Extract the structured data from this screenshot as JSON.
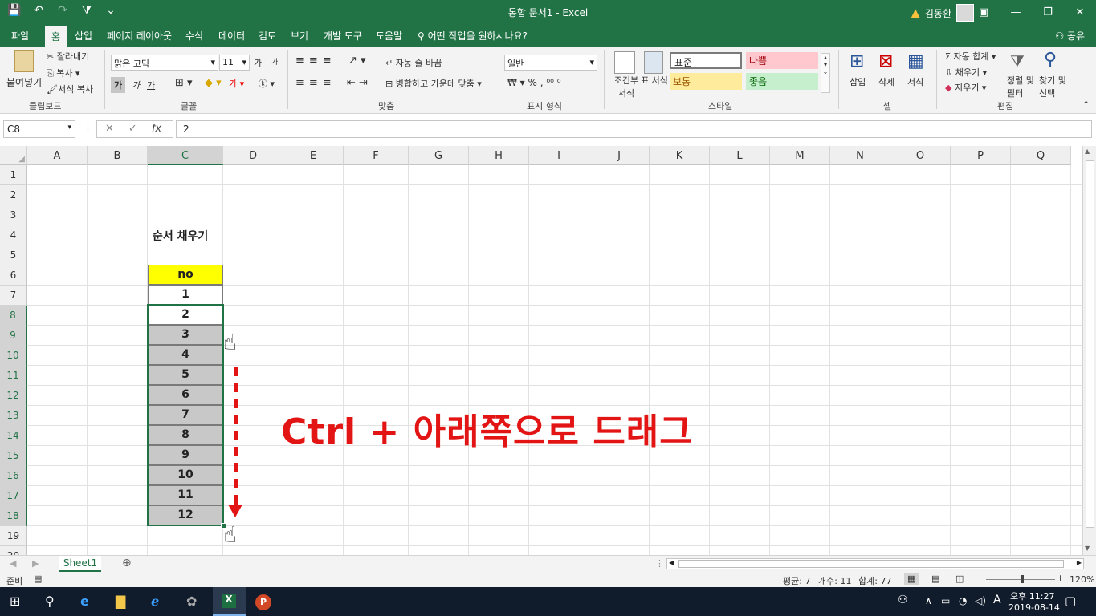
{
  "window": {
    "title": "통합 문서1  -  Excel",
    "user": "김동환"
  },
  "qat": {
    "save": "💾",
    "undo": "↶",
    "redo": "↷",
    "touch": "⧩",
    "more": "⌄"
  },
  "tabs": [
    "파일",
    "홈",
    "삽입",
    "페이지 레이아웃",
    "수식",
    "데이터",
    "검토",
    "보기",
    "개발 도구",
    "도움말"
  ],
  "tell_me": "어떤 작업을 원하시나요?",
  "share": "공유",
  "ribbon": {
    "clipboard": {
      "paste": "붙여넣기",
      "cut": "잘라내기",
      "copy": "복사",
      "format_painter": "서식 복사",
      "label": "클립보드"
    },
    "font": {
      "name": "맑은 고딕",
      "size": "11",
      "grow": "가",
      "shrink": "가",
      "bold": "가",
      "italic": "가",
      "underline": "가",
      "label": "글꼴"
    },
    "alignment": {
      "wrap": "자동 줄 바꿈",
      "merge": "병합하고 가운데 맞춤",
      "label": "맞춤"
    },
    "number": {
      "format": "일반",
      "label": "표시 형식"
    },
    "styles": {
      "conditional": "조건부 서식",
      "table": "표 서식",
      "normal": "표준",
      "bad": "나쁨",
      "neutral": "보통",
      "good": "좋음",
      "label": "스타일"
    },
    "cells": {
      "insert": "삽입",
      "delete": "삭제",
      "format": "서식",
      "label": "셀"
    },
    "editing": {
      "autosum": "자동 합계",
      "fill": "채우기",
      "clear": "지우기",
      "sort": "정렬 및 필터",
      "find": "찾기 및 선택",
      "label": "편집"
    }
  },
  "formula_bar": {
    "namebox": "C8",
    "value": "2"
  },
  "columns": [
    "A",
    "B",
    "C",
    "D",
    "E",
    "F",
    "G",
    "H",
    "I",
    "J",
    "K",
    "L",
    "M",
    "N",
    "O",
    "P",
    "Q"
  ],
  "rows": [
    "1",
    "2",
    "3",
    "4",
    "5",
    "6",
    "7",
    "8",
    "9",
    "10",
    "11",
    "12",
    "13",
    "14",
    "15",
    "16",
    "17",
    "18",
    "19",
    "20"
  ],
  "sheet_cells": {
    "title": "순서 채우기",
    "header": "no",
    "values": [
      "1",
      "2",
      "3",
      "4",
      "5",
      "6",
      "7",
      "8",
      "9",
      "10",
      "11",
      "12"
    ]
  },
  "annotation": "Ctrl + 아래쪽으로 드래그",
  "sheet_tab": "Sheet1",
  "status": {
    "ready": "준비",
    "average": "평균: 7",
    "count": "개수: 11",
    "sum": "합계: 77",
    "zoom": "120%"
  },
  "taskbar": {
    "time": "오후 11:27",
    "date": "2019-08-14",
    "ime": "A"
  },
  "colors": {
    "accent": "#217346",
    "annotation": "#e31414",
    "header_fill": "#ffff00"
  }
}
